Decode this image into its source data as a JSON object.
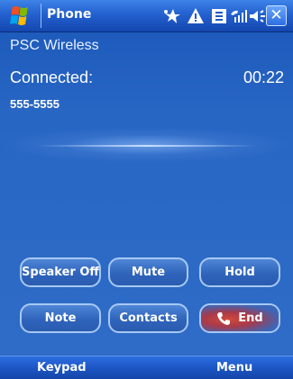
{
  "titlebar": {
    "app_title": "Phone",
    "close_label": "✕"
  },
  "call": {
    "carrier": "PSC Wireless",
    "status": "Connected:",
    "timer": "00:22",
    "number": "555-5555"
  },
  "buttons": {
    "speaker": "Speaker Off",
    "mute": "Mute",
    "hold": "Hold",
    "note": "Note",
    "contacts": "Contacts",
    "end": "End"
  },
  "menubar": {
    "left": "Keypad",
    "right": "Menu"
  },
  "colors": {
    "accent": "#2361cf",
    "end_call": "#d24a3a"
  },
  "icons": [
    "windows-start-icon",
    "network-activity-icon",
    "alert-icon",
    "storage-icon",
    "signal-icon",
    "volume-icon",
    "close-icon",
    "phone-icon"
  ]
}
